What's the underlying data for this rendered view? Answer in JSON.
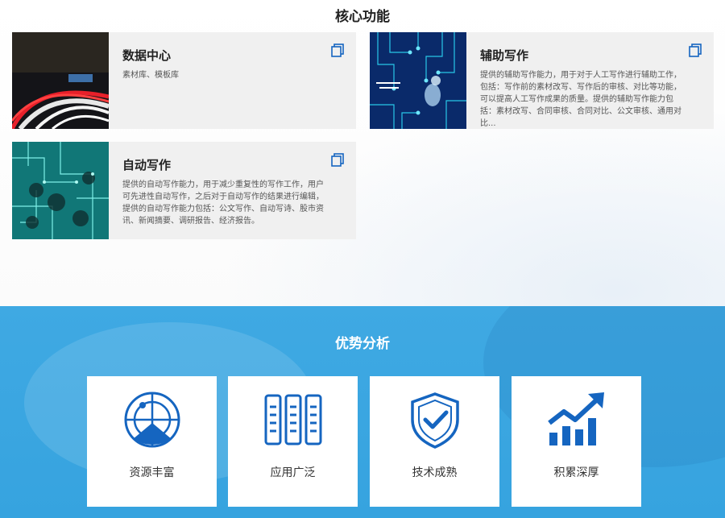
{
  "core": {
    "title": "核心功能",
    "cards": [
      {
        "title": "数据中心",
        "desc": "素材库、模板库"
      },
      {
        "title": "辅助写作",
        "desc": "提供的辅助写作能力，用于对于人工写作进行辅助工作，包括：写作前的素材改写、写作后的审核、对比等功能，可以提高人工写作成果的质量。提供的辅助写作能力包括：素材改写、合同审核、合同对比、公文审核、通用对比..."
      },
      {
        "title": "自动写作",
        "desc": "提供的自动写作能力，用于减少重复性的写作工作，用户可先进性自动写作，之后对于自动写作的结果进行编辑，提供的自动写作能力包括：公文写作、自动写诗、股市资讯、新闻摘要、调研报告、经济报告。"
      }
    ]
  },
  "advantages": {
    "title": "优势分析",
    "items": [
      {
        "label": "资源丰富",
        "icon": "radar-icon"
      },
      {
        "label": "应用广泛",
        "icon": "server-racks-icon"
      },
      {
        "label": "技术成熟",
        "icon": "shield-check-icon"
      },
      {
        "label": "积累深厚",
        "icon": "growth-chart-icon"
      }
    ]
  },
  "colors": {
    "accent": "#1565c0",
    "band": "#3fa9e3"
  }
}
